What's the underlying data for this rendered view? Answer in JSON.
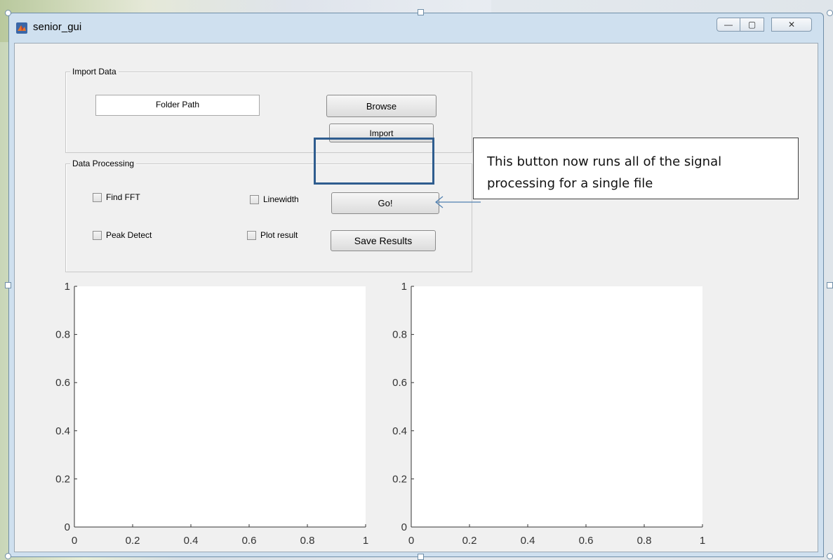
{
  "window": {
    "title": "senior_gui",
    "icon": "matlab-icon"
  },
  "controls": {
    "minimize": "—",
    "maximize": "▢",
    "close": "✕"
  },
  "import_panel": {
    "title": "Import Data",
    "folder_path": "Folder Path",
    "browse_label": "Browse",
    "import_label": "Import"
  },
  "processing_panel": {
    "title": "Data Processing",
    "find_fft": "Find FFT",
    "peak_detect": "Peak Detect",
    "linewidth": "Linewidth",
    "plot_result": "Plot result",
    "go_label": "Go!",
    "save_label": "Save Results"
  },
  "callout": {
    "text": "This button now runs all of the signal processing for a single file",
    "border_color": "#2f5d8f"
  },
  "axes": [
    {
      "xticks": [
        "0",
        "0.2",
        "0.4",
        "0.6",
        "0.8",
        "1"
      ],
      "yticks": [
        "0",
        "0.2",
        "0.4",
        "0.6",
        "0.8",
        "1"
      ],
      "xlim": [
        0,
        1
      ],
      "ylim": [
        0,
        1
      ]
    },
    {
      "xticks": [
        "0",
        "0.2",
        "0.4",
        "0.6",
        "0.8",
        "1"
      ],
      "yticks": [
        "0",
        "0.2",
        "0.4",
        "0.6",
        "0.8",
        "1"
      ],
      "xlim": [
        0,
        1
      ],
      "ylim": [
        0,
        1
      ]
    }
  ]
}
